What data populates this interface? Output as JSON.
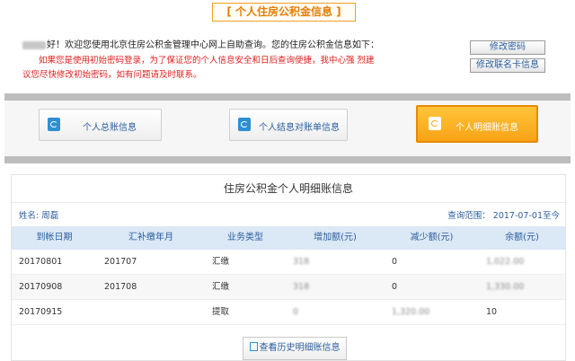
{
  "page": {
    "title": "[ 个人住房公积金信息 ]"
  },
  "welcome": {
    "line1": "好！欢迎您使用北京住房公积金管理中心网上自助查询。您的住房公积金信息如下：",
    "line2": "如果您是使用初始密码登录，为了保证您的个人信息安全和日后查询便捷，我中心强 烈建",
    "line3": "议您尽快修改初始密码，如有问题请及时联系。",
    "change_password": "修改密码",
    "change_card": "修改联名卡信息"
  },
  "nav": {
    "items": [
      {
        "label": "个人总账信息",
        "icon": "account-book-icon"
      },
      {
        "label": "个人结息对账单信息",
        "icon": "statement-icon"
      },
      {
        "label": "个人明细账信息",
        "icon": "detail-icon",
        "active": true
      }
    ]
  },
  "detail": {
    "panel_title": "住房公积金个人明细账信息",
    "name_label": "姓名: 周磊",
    "range_label": "查询范围： 2017-07-01至今",
    "columns": [
      "到帐日期",
      "汇补缴年月",
      "业务类型",
      "增加额(元)",
      "减少额(元)",
      "余额(元)"
    ],
    "rows": [
      {
        "date": "20170801",
        "month": "201707",
        "type": "汇缴",
        "increase": "318",
        "decrease": "0",
        "balance": "1,022.00"
      },
      {
        "date": "20170908",
        "month": "201708",
        "type": "汇缴",
        "increase": "318",
        "decrease": "0",
        "balance": "1,330.00"
      },
      {
        "date": "20170915",
        "month": "",
        "type": "提取",
        "increase": "0",
        "decrease": "1,320.00",
        "balance": "10"
      }
    ],
    "history_button": "查看历史明细账信息"
  }
}
